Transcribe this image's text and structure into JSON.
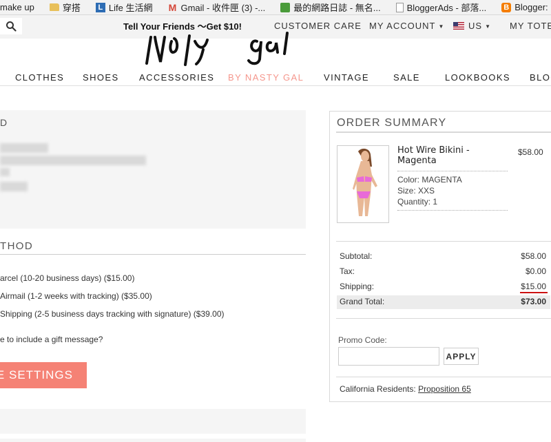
{
  "bookmarks": [
    {
      "label": "make up",
      "icon": "none"
    },
    {
      "label": "穿搭",
      "icon": "folder-icon"
    },
    {
      "label": "Life 生活網",
      "icon": "l-icon"
    },
    {
      "label": "Gmail - 收件匣 (3) -...",
      "icon": "gmail-icon"
    },
    {
      "label": "最的網路日誌 - 無名...",
      "icon": "blog-icon"
    },
    {
      "label": "BloggerAds - 部落...",
      "icon": "page-icon"
    },
    {
      "label": "Blogger: Blogger ...",
      "icon": "blogger-icon"
    }
  ],
  "topbar": {
    "promo": "Tell Your Friends 〜Get $10!",
    "customer_care": "CUSTOMER CARE",
    "my_account": "MY ACCOUNT",
    "region": "US",
    "my_tote": "MY TOTE"
  },
  "nav": [
    "CLOTHES",
    "SHOES",
    "ACCESSORIES",
    "BY NASTY GAL",
    "VINTAGE",
    "SALE",
    "LOOKBOOKS",
    "BLOG"
  ],
  "shipping": {
    "title": "THOD",
    "options": [
      "arcel (10-20 business days) ($15.00)",
      "Airmail (1-2 weeks with tracking) ($35.00)",
      "Shipping (2-5 business days tracking with signature) ($39.00)"
    ],
    "gift_question": "e to include a gift message?",
    "save_button": "HESE SETTINGS"
  },
  "address_panel": {
    "partial_label": "D"
  },
  "summary": {
    "title": "ORDER SUMMARY",
    "product": {
      "name": "Hot Wire Bikini - Magenta",
      "price": "$58.00",
      "color": "Color: MAGENTA",
      "size": "Size: XXS",
      "quantity": "Quantity: 1"
    },
    "totals": {
      "subtotal_label": "Subtotal:",
      "subtotal": "$58.00",
      "tax_label": "Tax:",
      "tax": "$0.00",
      "shipping_label": "Shipping:",
      "shipping": "$15.00",
      "grand_label": "Grand Total:",
      "grand": "$73.00"
    },
    "promo_label": "Promo Code:",
    "promo_value": "",
    "apply": "APPLY",
    "ca_text": "California Residents:",
    "ca_link": "Proposition 65"
  },
  "colors": {
    "accent": "#f58275",
    "nav_highlight": "#f5968c",
    "shipping_underline": "#cc1111"
  }
}
